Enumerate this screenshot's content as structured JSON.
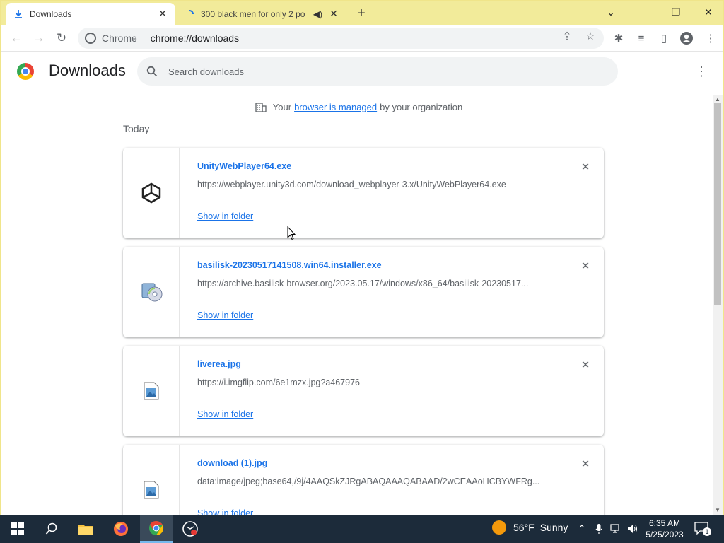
{
  "tabs": [
    {
      "title": "Downloads",
      "icon": "download-icon",
      "active": true
    },
    {
      "title": "300 black men for only 2 po",
      "icon": "loading-icon",
      "audio": true,
      "active": false
    }
  ],
  "window": {
    "new_tab": "+",
    "minimize": "—",
    "restore": "❐",
    "close": "✕",
    "tab_search": "⌄"
  },
  "toolbar": {
    "site_name": "Chrome",
    "url": "chrome://downloads"
  },
  "page": {
    "title": "Downloads",
    "search_placeholder": "Search downloads",
    "managed_prefix": "Your",
    "managed_link": "browser is managed",
    "managed_suffix": "by your organization",
    "section": "Today"
  },
  "downloads": [
    {
      "name": "UnityWebPlayer64.exe",
      "url": "https://webplayer.unity3d.com/download_webplayer-3.x/UnityWebPlayer64.exe",
      "action": "Show in folder",
      "icon": "unity-icon"
    },
    {
      "name": "basilisk-20230517141508.win64.installer.exe",
      "url": "https://archive.basilisk-browser.org/2023.05.17/windows/x86_64/basilisk-20230517...",
      "action": "Show in folder",
      "icon": "installer-icon"
    },
    {
      "name": "liverea.jpg",
      "url": "https://i.imgflip.com/6e1mzx.jpg?a467976",
      "action": "Show in folder",
      "icon": "image-file-icon"
    },
    {
      "name": "download (1).jpg",
      "url": "data:image/jpeg;base64,/9j/4AAQSkZJRgABAQAAAQABAAD/2wCEAAoHCBYWFRg...",
      "action": "Show in folder",
      "icon": "image-file-icon"
    }
  ],
  "taskbar": {
    "weather_temp": "56°F",
    "weather_text": "Sunny",
    "time": "6:35 AM",
    "date": "5/25/2023",
    "notifications": "1"
  },
  "colors": {
    "accent": "#1a73e8",
    "tabstrip": "#f2eb9a",
    "taskbar": "#1c2b3a"
  }
}
